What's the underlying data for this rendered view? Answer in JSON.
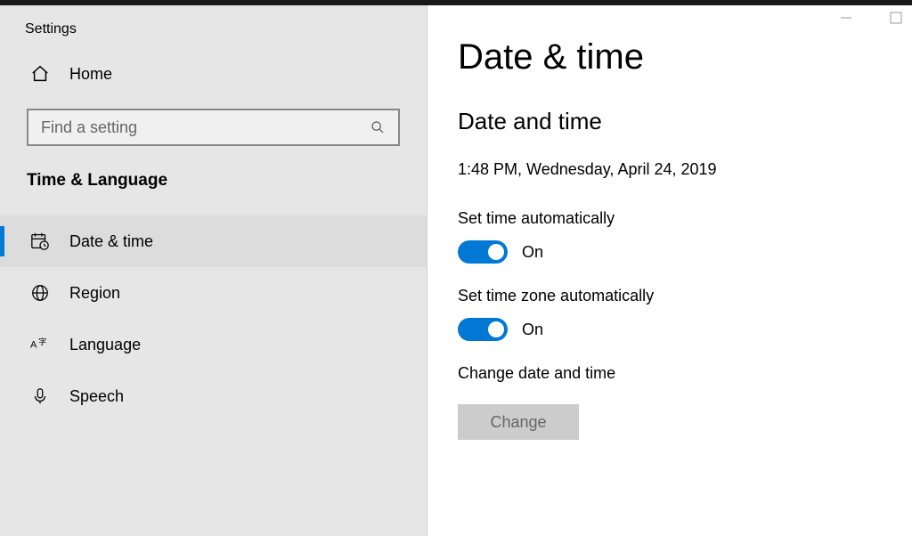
{
  "window": {
    "title": "Settings"
  },
  "sidebar": {
    "home_label": "Home",
    "search_placeholder": "Find a setting",
    "category_label": "Time & Language",
    "items": [
      {
        "label": "Date & time",
        "active": true
      },
      {
        "label": "Region",
        "active": false
      },
      {
        "label": "Language",
        "active": false
      },
      {
        "label": "Speech",
        "active": false
      }
    ]
  },
  "main": {
    "page_title": "Date & time",
    "section_title": "Date and time",
    "current_datetime": "1:48 PM, Wednesday, April 24, 2019",
    "set_time_auto_label": "Set time automatically",
    "set_time_auto_state": "On",
    "set_tz_auto_label": "Set time zone automatically",
    "set_tz_auto_state": "On",
    "change_label": "Change date and time",
    "change_button": "Change"
  },
  "colors": {
    "accent": "#0078d4",
    "sidebar_bg": "#e6e6e6"
  }
}
